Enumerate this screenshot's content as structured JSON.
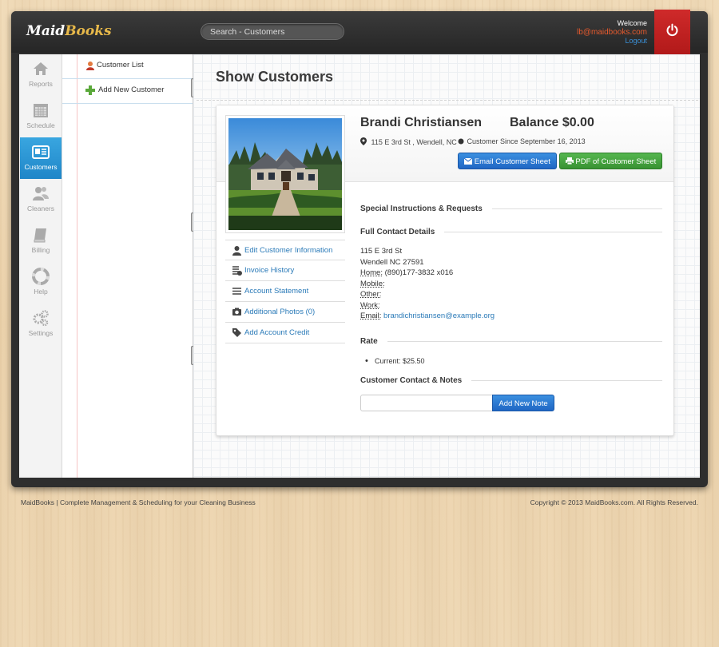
{
  "header": {
    "logo_maid": "Maid",
    "logo_books": "Books",
    "search_placeholder": "Search - Customers",
    "welcome": "Welcome",
    "email": "lb@maidbooks.com",
    "logout": "Logout",
    "power_icon": "power-icon"
  },
  "nav": {
    "items": [
      {
        "label": "Reports",
        "icon": "home-icon"
      },
      {
        "label": "Schedule",
        "icon": "calendar-icon"
      },
      {
        "label": "Customers",
        "icon": "id-card-icon",
        "active": true
      },
      {
        "label": "Cleaners",
        "icon": "people-icon"
      },
      {
        "label": "Billing",
        "icon": "book-icon"
      },
      {
        "label": "Help",
        "icon": "lifebuoy-icon"
      },
      {
        "label": "Settings",
        "icon": "gears-icon"
      }
    ]
  },
  "subnav": {
    "items": [
      {
        "label": "Customer List",
        "icon": "person-icon"
      },
      {
        "label": "Add New Customer",
        "icon": "plus-icon"
      }
    ]
  },
  "page": {
    "title": "Show Customers"
  },
  "customer": {
    "name": "Brandi Christiansen",
    "balance": "Balance $0.00",
    "address_line": "115 E 3rd St , Wendell, NC",
    "since": "Customer Since September 16, 2013",
    "email_sheet_btn": "Email Customer Sheet",
    "pdf_sheet_btn": "PDF of Customer Sheet"
  },
  "side_links": [
    {
      "label": "Edit Customer Information",
      "icon": "user-icon"
    },
    {
      "label": "Invoice History",
      "icon": "invoice-icon"
    },
    {
      "label": "Account Statement",
      "icon": "list-icon"
    },
    {
      "label": "Additional Photos (0)",
      "icon": "camera-icon"
    },
    {
      "label": "Add Account Credit",
      "icon": "tag-icon"
    }
  ],
  "sections": {
    "special": "Special Instructions & Requests",
    "contact": "Full Contact Details",
    "rate": "Rate",
    "notes": "Customer Contact & Notes"
  },
  "contact": {
    "street": "115 E 3rd St",
    "city": "Wendell NC 27591",
    "home_label": "Home:",
    "home_value": " (890)177-3832 x016",
    "mobile_label": "Mobile:",
    "other_label": "Other:",
    "work_label": "Work:",
    "email_label": "Email:",
    "email_value": "brandichristiansen@example.org"
  },
  "rate": {
    "current": "Current: $25.50"
  },
  "notes": {
    "add_btn": "Add New Note",
    "input_value": ""
  },
  "footer": {
    "left": "MaidBooks | Complete Management & Scheduling for your Cleaning Business",
    "right": "Copyright © 2013 MaidBooks.com. All Rights Reserved."
  }
}
